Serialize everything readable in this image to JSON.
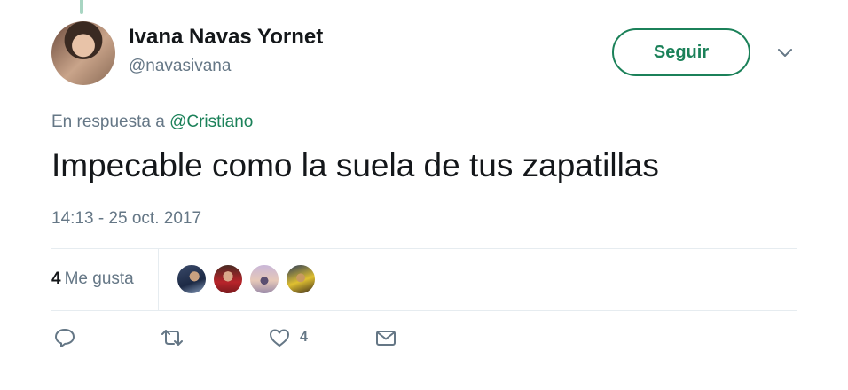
{
  "tweet": {
    "author_name": "Ivana Navas Yornet",
    "author_handle": "@navasivana",
    "follow_label": "Seguir",
    "reply_prefix": "En respuesta a",
    "reply_mention": "@Cristiano",
    "text": "Impecable como la suela de tus zapatillas",
    "timestamp": "14:13 - 25 oct. 2017"
  },
  "stats": {
    "likes_count": "4",
    "likes_label": "Me gusta",
    "liker_avatars": 4
  },
  "actions": {
    "reply_icon": "reply-icon",
    "retweet_icon": "retweet-icon",
    "like_icon": "heart-icon",
    "like_count": "4",
    "message_icon": "envelope-icon"
  },
  "colors": {
    "accent": "#1b8159",
    "secondary_text": "#657786",
    "primary_text": "#14171a",
    "divider": "#e6ecf0"
  }
}
